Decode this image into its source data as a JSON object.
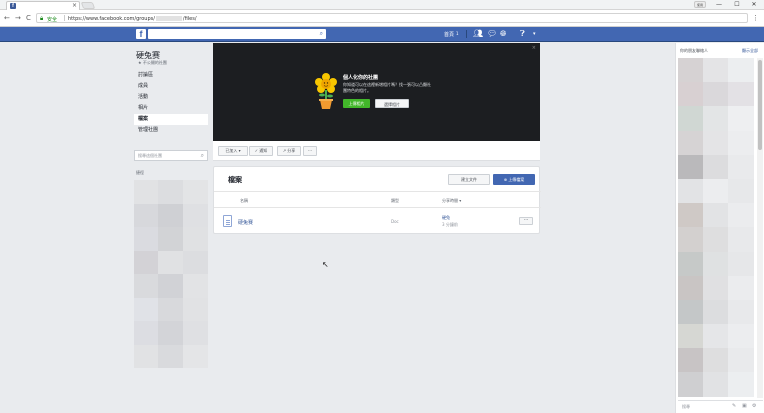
{
  "browser": {
    "tab_favicon": "f",
    "tab_close": "×",
    "user_button": "使用",
    "window_controls": [
      "—",
      "☐",
      "✕"
    ],
    "nav": {
      "back": "←",
      "forward": "→",
      "reload": "C"
    },
    "secure_label": "安全",
    "url_prefix": "https://www.facebook.com/groups/",
    "url_suffix": "/files/",
    "menu_icon": "⋮"
  },
  "fb_bar": {
    "logo": "f",
    "search_placeholder": "",
    "home_label": "首頁",
    "home_badge": "1"
  },
  "group": {
    "title": "硬兔赛",
    "subtitle": "★ 不公開的社團"
  },
  "left_nav": {
    "items": [
      "討論區",
      "成員",
      "活動",
      "相片",
      "檔案",
      "管理社團"
    ],
    "active_index": 4,
    "search_placeholder": "搜尋這個社團",
    "section_label": "捷徑"
  },
  "cover": {
    "title": "個人化你的社團",
    "description": "你知道可以在這裡新增相片嗎？找一張可以凸顯社團特色的相片。",
    "upload_button": "上傳相片",
    "choose_button": "選擇相片",
    "close": "×"
  },
  "actions": {
    "joined": "已加入 ▾",
    "notifications": "✓ 通知",
    "share": "↗ 分享",
    "more": "···"
  },
  "files": {
    "title": "檔案",
    "create_doc": "建立文件",
    "upload_file": "⊕ 上傳檔案",
    "columns": {
      "name": "名稱",
      "type": "類型",
      "uploaded": "分享時間 ▾"
    },
    "rows": [
      {
        "name": "硬兔赛",
        "type": "Doc",
        "author": "硬兔",
        "time": "3 分鐘前",
        "more": "···"
      }
    ]
  },
  "right_sidebar": {
    "title": "你的朋友聯絡人",
    "link": "顯示全部",
    "search_placeholder": "搜尋"
  },
  "colors": {
    "fb_blue": "#4267b2",
    "green": "#42b72a",
    "background": "#e9ebee"
  }
}
